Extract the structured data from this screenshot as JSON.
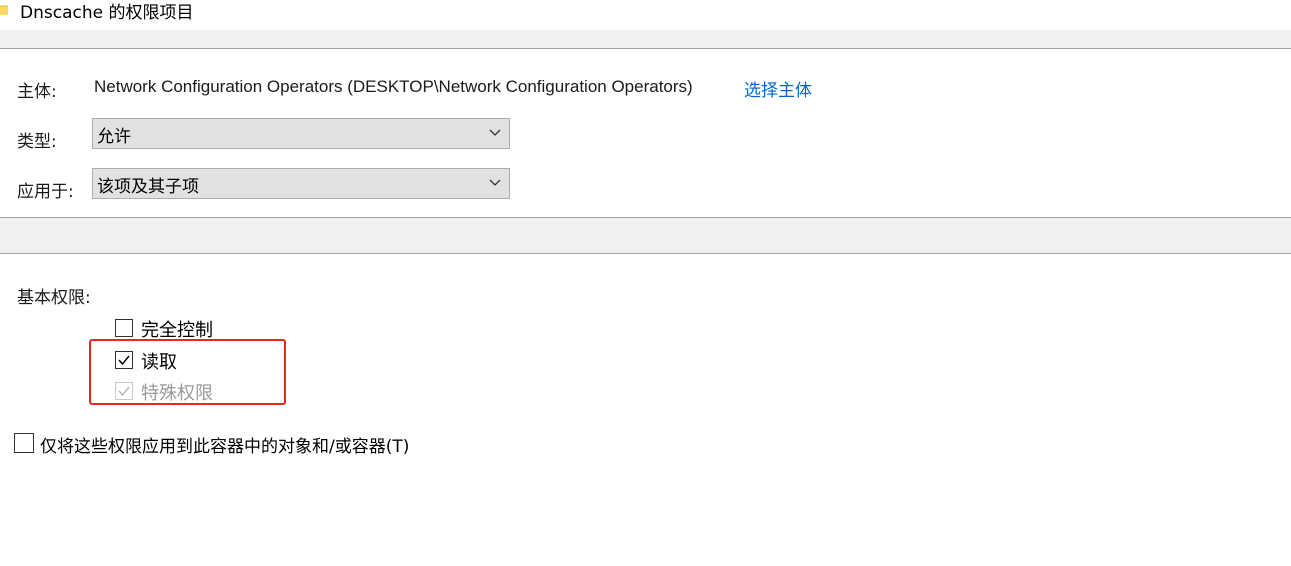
{
  "window": {
    "title": "Dnscache 的权限项目",
    "icon": "folder-icon"
  },
  "principal": {
    "label": "主体:",
    "value": "Network Configuration Operators (DESKTOP\\Network Configuration Operators)",
    "select_link": "选择主体"
  },
  "type": {
    "label": "类型:",
    "selected": "允许"
  },
  "applies_to": {
    "label": "应用于:",
    "selected": "该项及其子项"
  },
  "basic_permissions": {
    "label": "基本权限:",
    "items": [
      {
        "label": "完全控制",
        "checked": false,
        "disabled": false
      },
      {
        "label": "读取",
        "checked": true,
        "disabled": false
      },
      {
        "label": "特殊权限",
        "checked": true,
        "disabled": true
      }
    ]
  },
  "apply_only": {
    "label": "仅将这些权限应用到此容器中的对象和/或容器(T)",
    "checked": false
  },
  "colors": {
    "link": "#0066cc",
    "highlight": "#e8281e",
    "band": "#f0f0f0"
  }
}
